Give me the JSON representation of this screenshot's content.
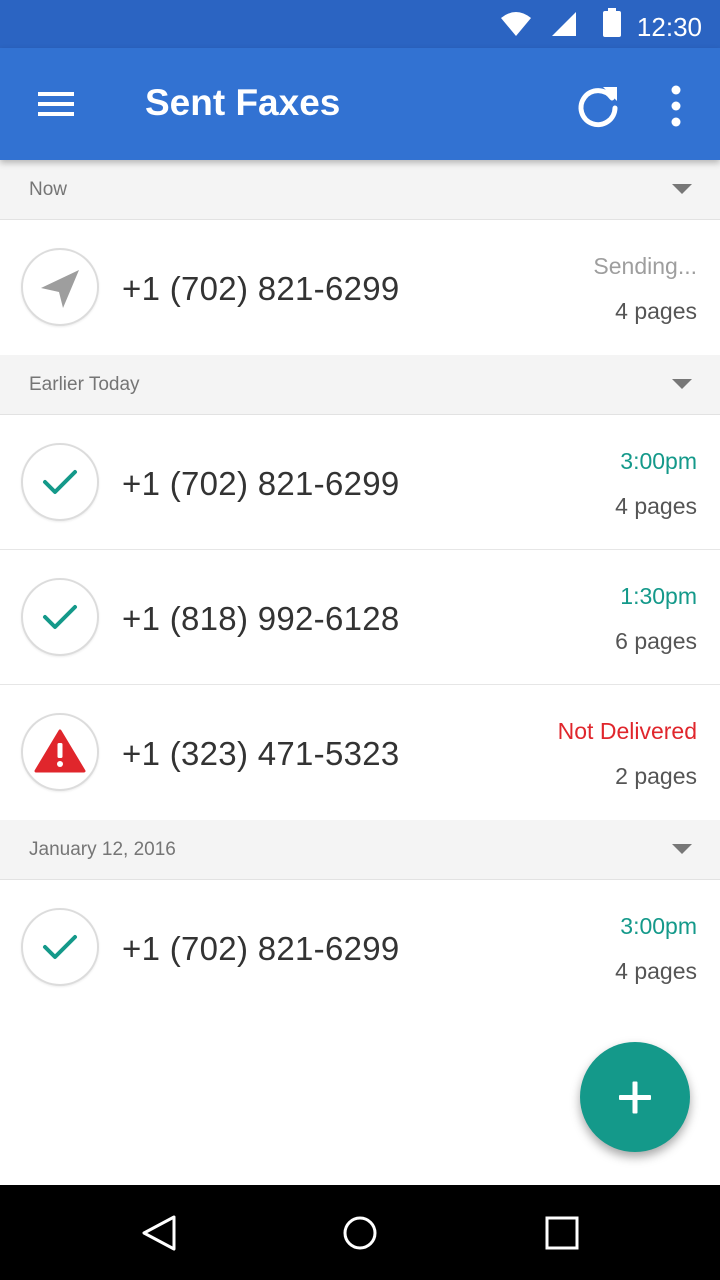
{
  "status_bar": {
    "time": "12:30",
    "icons": [
      "wifi-icon",
      "cell-signal-icon",
      "battery-icon"
    ]
  },
  "app_bar": {
    "title": "Sent Faxes",
    "icons": [
      "menu-icon",
      "refresh-icon",
      "more-vert-icon"
    ]
  },
  "sections": [
    {
      "label": "Now",
      "items": [
        {
          "phone": "+1 (702) 821-6299",
          "status": "Sending...",
          "status_type": "sending",
          "pages": "4 pages"
        }
      ]
    },
    {
      "label": "Earlier Today",
      "items": [
        {
          "phone": "+1 (702) 821-6299",
          "status": "3:00pm",
          "status_type": "sent",
          "pages": "4 pages"
        },
        {
          "phone": "+1 (818) 992-6128",
          "status": "1:30pm",
          "status_type": "sent",
          "pages": "6 pages"
        },
        {
          "phone": "+1 (323) 471-5323",
          "status": "Not Delivered",
          "status_type": "failed",
          "pages": "2 pages"
        }
      ]
    },
    {
      "label": "January 12, 2016",
      "items": [
        {
          "phone": "+1 (702) 821-6299",
          "status": "3:00pm",
          "status_type": "sent",
          "pages": "4 pages"
        }
      ]
    }
  ],
  "colors": {
    "status_bar": "#2b64c2",
    "app_bar": "#3272d2",
    "sending": "#9e9e9e",
    "sent": "#14998a",
    "failed": "#e0262c",
    "fab": "#14998a"
  },
  "fab": {
    "icon": "plus-icon"
  },
  "nav_bar": {
    "icons": [
      "back-icon",
      "home-icon",
      "recents-icon"
    ]
  }
}
